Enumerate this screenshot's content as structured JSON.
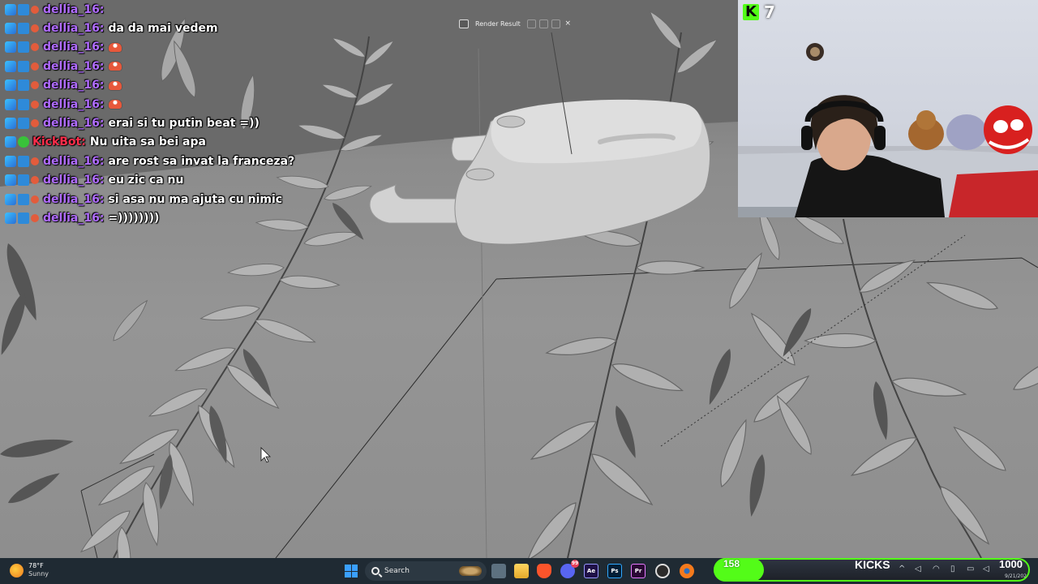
{
  "chat": [
    {
      "user": "dellia_16:",
      "message": "",
      "emoji": false,
      "bot": false
    },
    {
      "user": "dellia_16:",
      "message": "da da mai vedem",
      "emoji": false,
      "bot": false
    },
    {
      "user": "dellia_16:",
      "message": "",
      "emoji": true,
      "bot": false
    },
    {
      "user": "dellia_16:",
      "message": "",
      "emoji": true,
      "bot": false
    },
    {
      "user": "dellia_16:",
      "message": "",
      "emoji": true,
      "bot": false
    },
    {
      "user": "dellia_16:",
      "message": "",
      "emoji": true,
      "bot": false
    },
    {
      "user": "dellia_16:",
      "message": "erai si tu putin beat =))",
      "emoji": false,
      "bot": false
    },
    {
      "user": "KickBot:",
      "message": "Nu uita sa bei apa",
      "emoji": false,
      "bot": true
    },
    {
      "user": "dellia_16:",
      "message": "are rost sa invat la franceza?",
      "emoji": false,
      "bot": false
    },
    {
      "user": "dellia_16:",
      "message": "eu zic ca nu",
      "emoji": false,
      "bot": false
    },
    {
      "user": "dellia_16:",
      "message": "si asa nu ma ajuta cu nimic",
      "emoji": false,
      "bot": false
    },
    {
      "user": "dellia_16:",
      "message": "=))))))))",
      "emoji": false,
      "bot": false
    }
  ],
  "blender": {
    "render_label": "Render Result",
    "close_glyph": "×"
  },
  "webcam": {
    "viewer_count": "7"
  },
  "taskbar": {
    "weather_temp": "78°F",
    "weather_cond": "Sunny",
    "search_label": "Search",
    "apps": [
      "file-manager",
      "file-explorer",
      "brave-browser",
      "discord",
      "after-effects",
      "photoshop",
      "premiere-pro",
      "obs",
      "blender"
    ],
    "app_letters": {
      "ae": "Ae",
      "ps": "Ps",
      "pr": "Pr"
    },
    "date": "9/21/202"
  },
  "subathon": {
    "count": "158",
    "label": "KICKS",
    "goal": "1000",
    "progress": 0.158
  },
  "colors": {
    "kick_green": "#53fc18",
    "username": "#b06cff",
    "kickbot": "#ff2d4b",
    "taskbar": "#1f2a33"
  }
}
